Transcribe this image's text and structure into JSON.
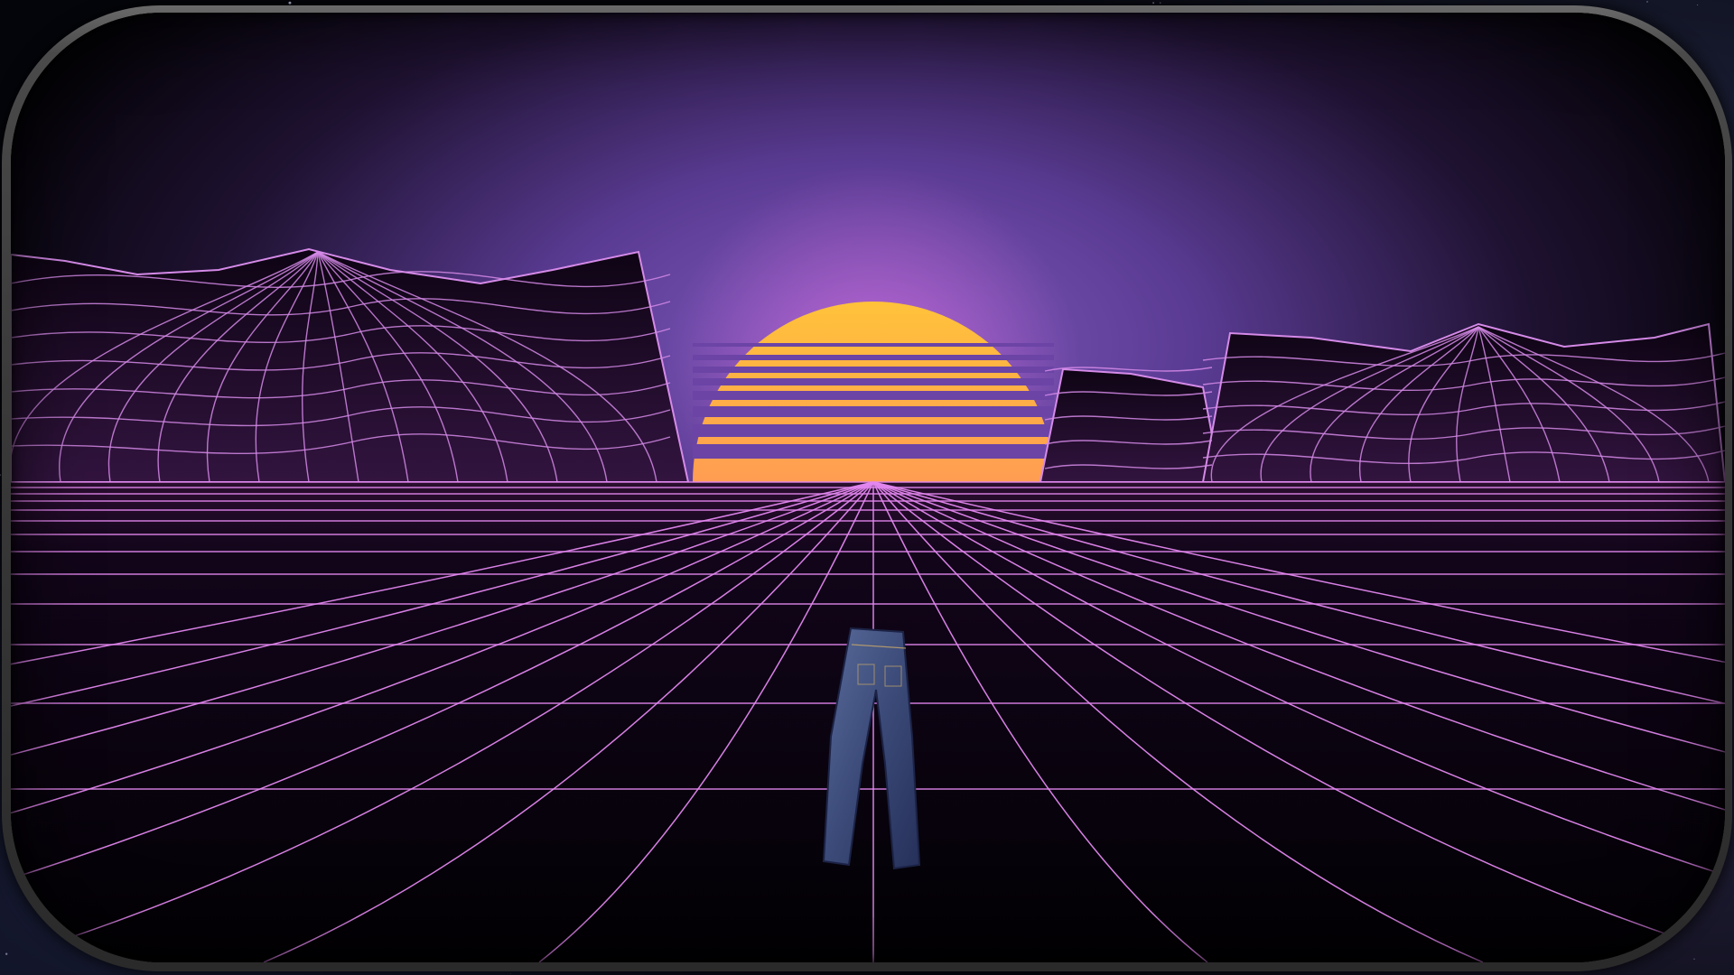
{
  "scene": {
    "name": "retrowave-sunset-grid",
    "colors": {
      "sky_top": "#050308",
      "sky_glow": "#7b56b5",
      "sun_top": "#ffc23a",
      "sun_bottom": "#ff5d9e",
      "grid_line": "#e487f0",
      "mountain_fill": "#1a0a22",
      "mountain_line": "#d58ae8",
      "floor": "#050208",
      "bezel": "#3d3d3d"
    },
    "objects": [
      {
        "name": "sun",
        "icon": "setting-sun-icon"
      },
      {
        "name": "left-mountain",
        "icon": "wireframe-mountain-icon"
      },
      {
        "name": "right-mountain",
        "icon": "wireframe-mountain-icon"
      },
      {
        "name": "grid-floor",
        "icon": "perspective-grid-icon"
      },
      {
        "name": "jeans",
        "icon": "denim-pants-icon"
      }
    ]
  }
}
